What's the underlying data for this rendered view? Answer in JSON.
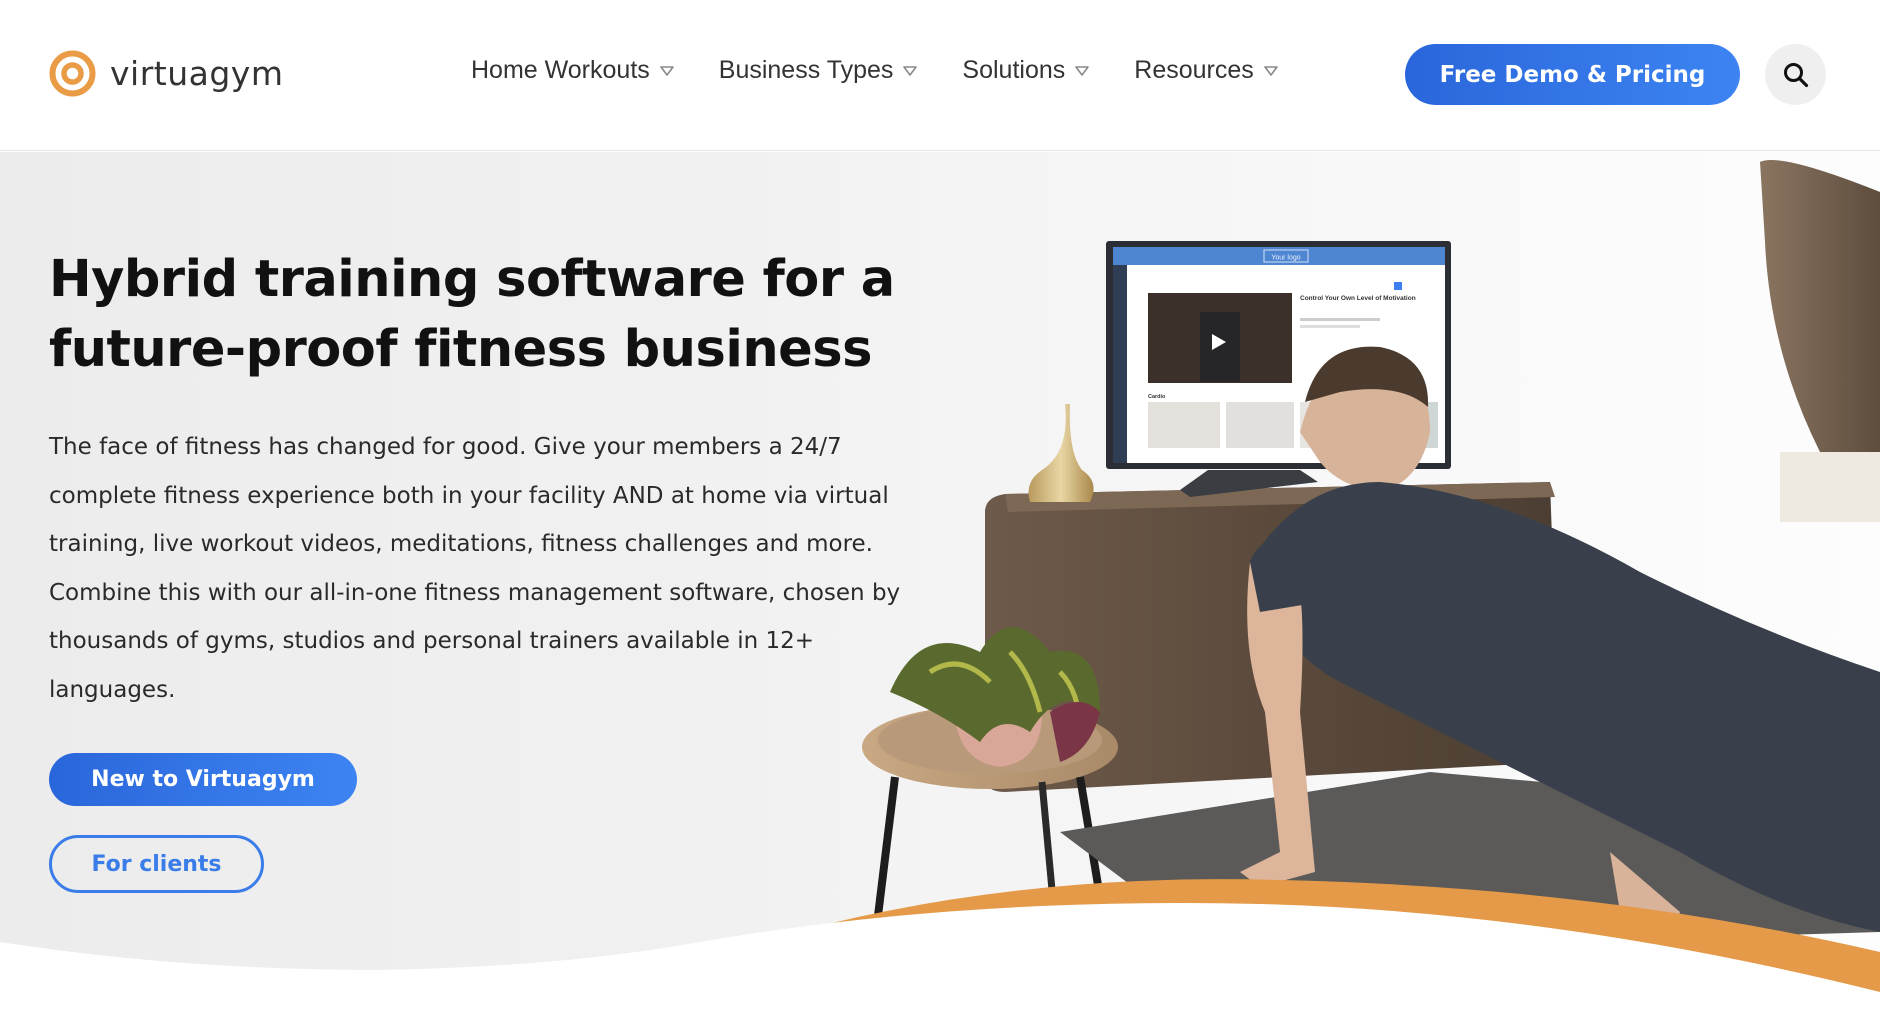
{
  "brand": {
    "name": "virtuagym",
    "accent_orange": "#e99b45",
    "accent_blue": "#2f72e6"
  },
  "header": {
    "nav": [
      {
        "label": "Home Workouts",
        "icon": "caret-down-icon"
      },
      {
        "label": "Business Types",
        "icon": "caret-down-icon"
      },
      {
        "label": "Solutions",
        "icon": "caret-down-icon"
      },
      {
        "label": "Resources",
        "icon": "caret-down-icon"
      }
    ],
    "cta_label": "Free Demo & Pricing",
    "search_icon": "search-icon"
  },
  "hero": {
    "title_line1": "Hybrid training software for a",
    "title_line2": "future-proof fitness business",
    "body": "The face of fitness has changed for good. Give your members a 24/7 complete fitness experience both in your facility AND at home via virtual training, live workout videos, meditations, fitness challenges and more. Combine this with our all-in-one fitness management software, chosen by thousands of gyms, studios and personal trainers available in 12+ languages.",
    "primary_button": "New to Virtuagym",
    "secondary_button": "For clients"
  },
  "illustration": {
    "screen_logo_text": "Your logo",
    "screen_video_title": "Control Your Own Level of Motivation",
    "screen_section_label": "Cardio"
  }
}
